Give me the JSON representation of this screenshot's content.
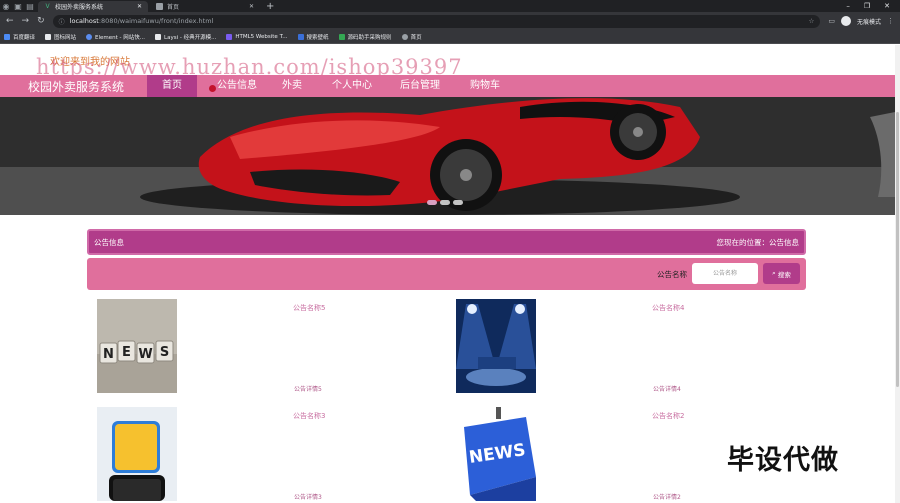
{
  "browser": {
    "tabs": [
      {
        "label": "校园外卖服务系统",
        "active": true
      },
      {
        "label": "首页",
        "active": false
      }
    ],
    "url_host": "localhost",
    "url_rest": ":8080/waimaifuwu/front/index.html",
    "profile_label": "无痕模式",
    "bookmarks": [
      "百度翻译",
      "图标网站",
      "Element - 网站快...",
      "Laysi - 经典开源模...",
      "HTML5 Website T...",
      "搜索壁纸",
      "源码助手采购规则",
      "首页"
    ]
  },
  "site": {
    "welcome": "欢迎来到我的网站",
    "watermark": "https://www.huzhan.com/ishop39397",
    "title": "校园外卖服务系统",
    "nav": [
      "首页",
      "公告信息",
      "外卖",
      "个人中心",
      "后台管理",
      "购物车"
    ],
    "active_nav": 0
  },
  "breadcrumb": {
    "title": "公告信息",
    "position": "您现在的位置：公告信息"
  },
  "search": {
    "label": "公告名称",
    "placeholder": "公告名称",
    "button": "搜索"
  },
  "notices": [
    {
      "name": "公告名称5",
      "detail": "公告详情5",
      "image": "news-blocks-image"
    },
    {
      "name": "公告名称4",
      "detail": "公告详情4",
      "image": "news-spotlight-image"
    },
    {
      "name": "公告名称3",
      "detail": "公告详情3",
      "image": "breaking-news-phone-image"
    },
    {
      "name": "公告名称2",
      "detail": "公告详情2",
      "image": "news-key-image"
    }
  ],
  "overlay_text": "毕设代做",
  "colors": {
    "nav_bg": "#e06f9c",
    "nav_active": "#b13c8a",
    "accent_text": "#c86ea0"
  }
}
